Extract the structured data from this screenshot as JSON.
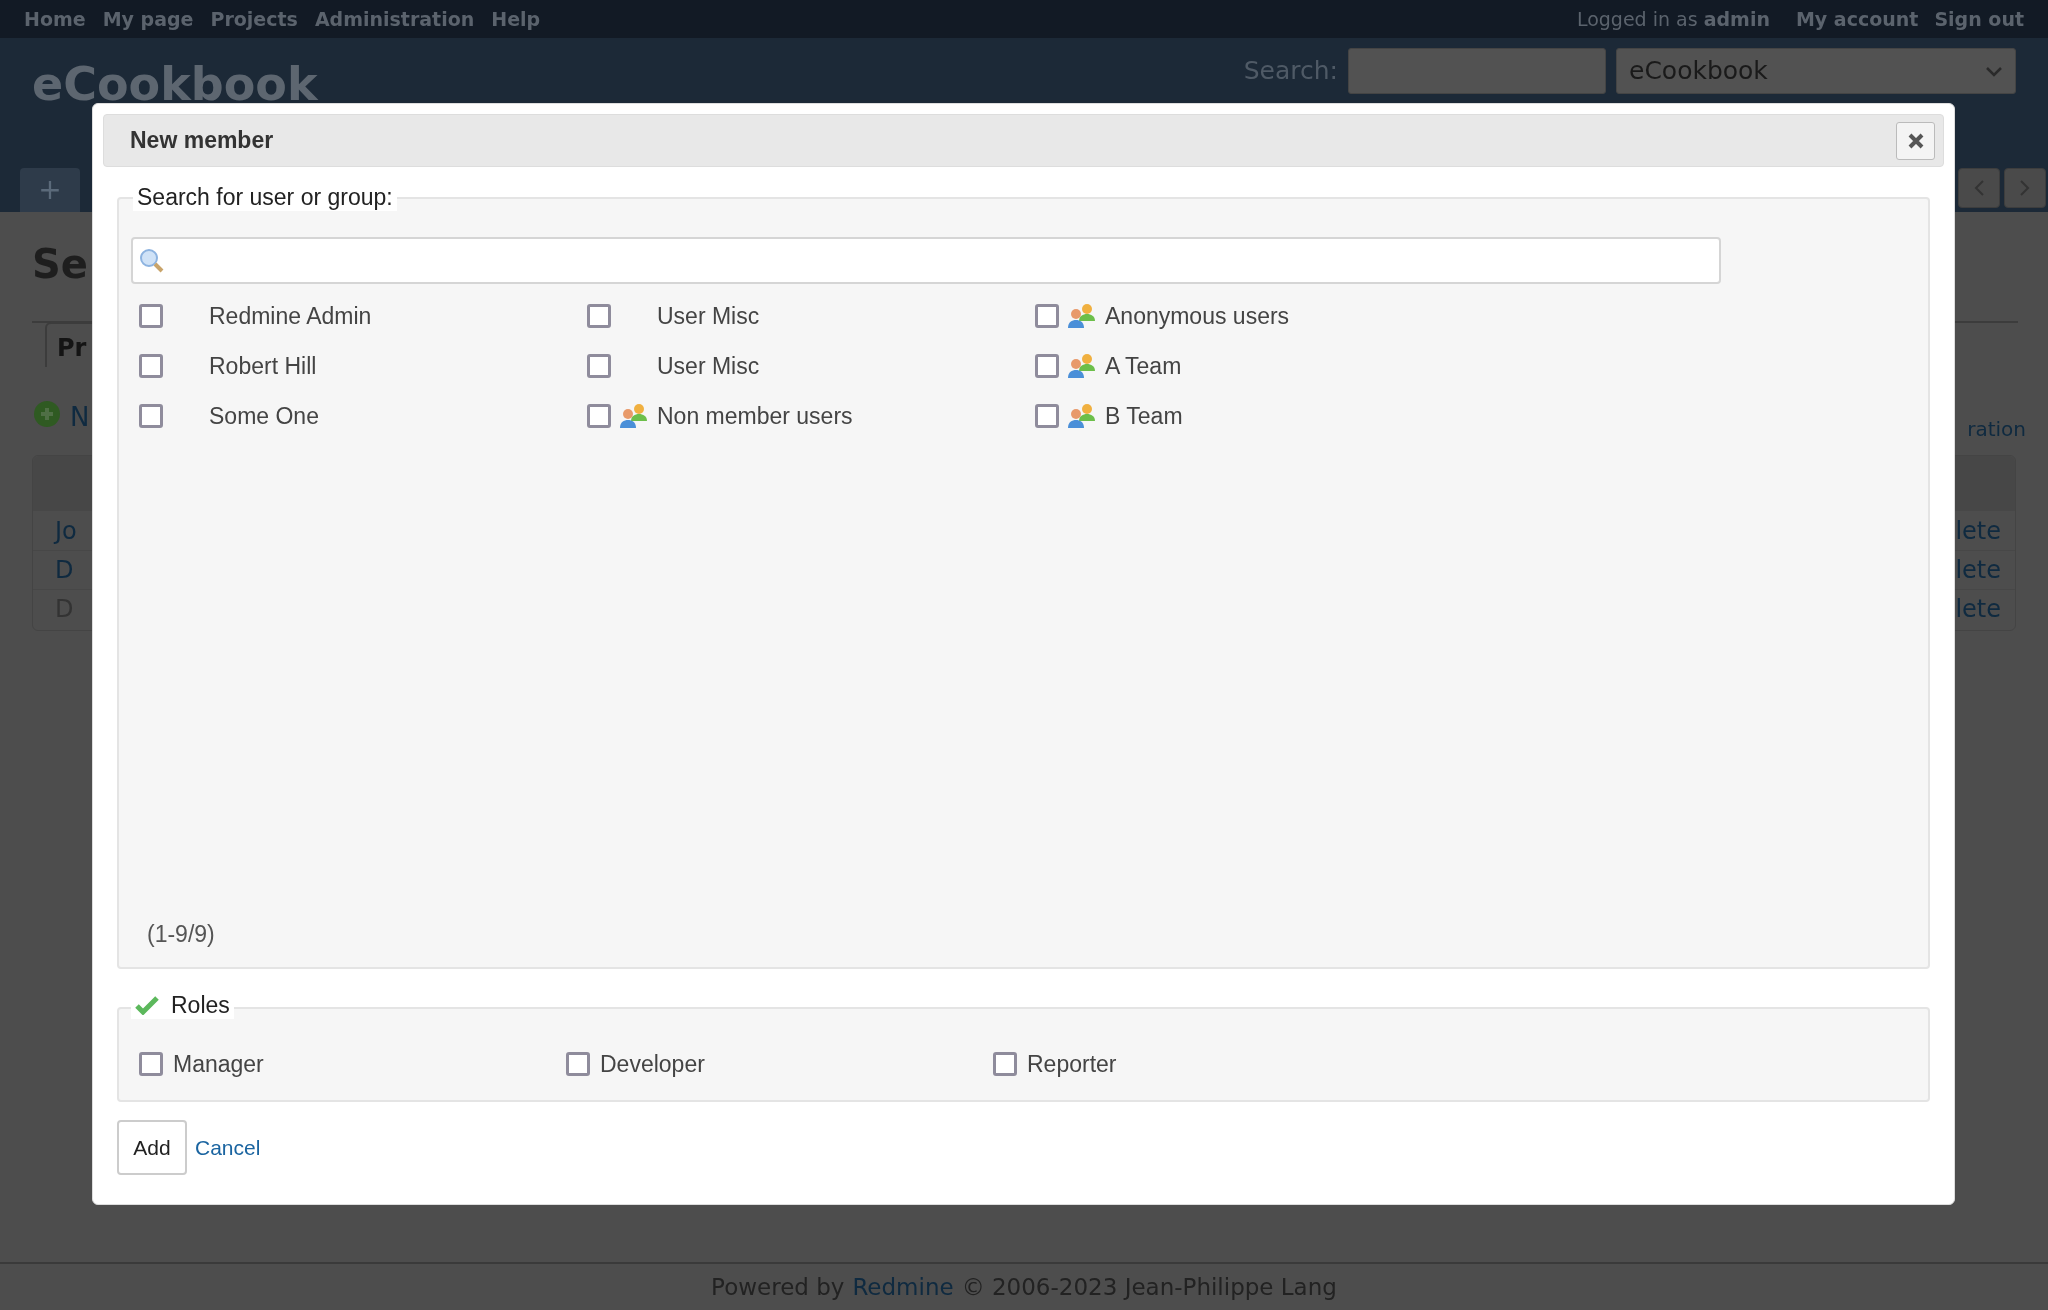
{
  "top_menu": {
    "links": [
      "Home",
      "My page",
      "Projects",
      "Administration",
      "Help"
    ],
    "logged_in": "Logged in as **admin**",
    "account_links": [
      "My account",
      "Sign out"
    ]
  },
  "header": {
    "title": "eCookbook",
    "search_label": "Search:",
    "project_select": "eCookbook",
    "new_tab": "+"
  },
  "page": {
    "heading": "Se",
    "tab": "Pr",
    "new_link": "N",
    "right_link": "ration",
    "rows": [
      {
        "name": "Jo",
        "disabled": false,
        "action": "lete"
      },
      {
        "name": "D",
        "disabled": false,
        "action": "lete"
      },
      {
        "name": "D",
        "disabled": true,
        "action": "lete"
      }
    ]
  },
  "dialog": {
    "title": "New member",
    "search_legend": "Search for user or group:",
    "principals": [
      {
        "name": "Redmine Admin",
        "kind": "user",
        "checked": false
      },
      {
        "name": "User Misc",
        "kind": "user",
        "checked": false
      },
      {
        "name": "Anonymous users",
        "kind": "group",
        "checked": false
      },
      {
        "name": "Robert Hill",
        "kind": "user",
        "checked": false
      },
      {
        "name": "User Misc",
        "kind": "user",
        "checked": false
      },
      {
        "name": "A Team",
        "kind": "group",
        "checked": false
      },
      {
        "name": "Some One",
        "kind": "user",
        "checked": false
      },
      {
        "name": "Non member users",
        "kind": "group",
        "checked": false
      },
      {
        "name": "B Team",
        "kind": "group",
        "checked": false
      }
    ],
    "count": "(1-9/9)",
    "roles_legend": "Roles",
    "roles": [
      {
        "name": "Manager",
        "checked": false
      },
      {
        "name": "Developer",
        "checked": false
      },
      {
        "name": "Reporter",
        "checked": false
      }
    ],
    "add_button": "Add",
    "cancel_link": "Cancel"
  },
  "footer": {
    "prefix": "Powered by",
    "link": "Redmine",
    "suffix": "© 2006-2023 Jean-Philippe Lang"
  }
}
